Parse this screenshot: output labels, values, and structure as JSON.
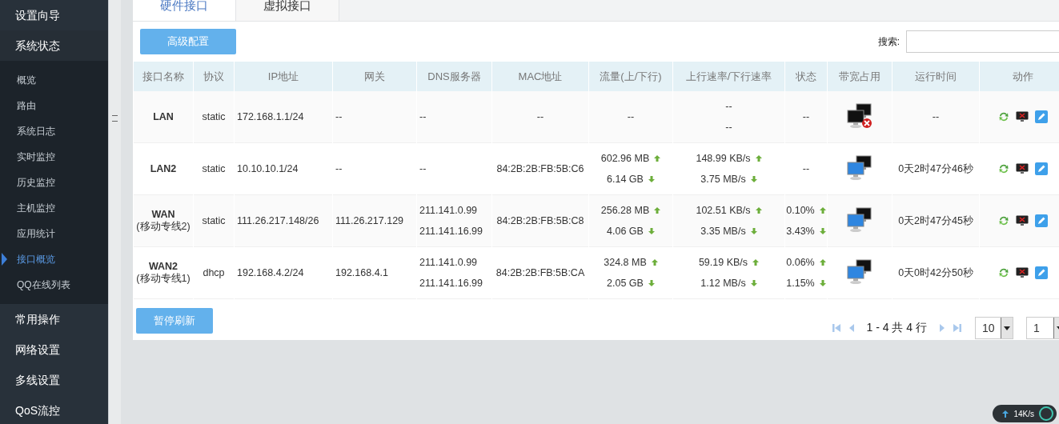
{
  "sidebar": {
    "sections": [
      {
        "label": "设置向导"
      },
      {
        "label": "系统状态",
        "children": [
          {
            "label": "概览",
            "selected": false
          },
          {
            "label": "路由",
            "selected": false
          },
          {
            "label": "系统日志",
            "selected": false
          },
          {
            "label": "实时监控",
            "selected": false
          },
          {
            "label": "历史监控",
            "selected": false
          },
          {
            "label": "主机监控",
            "selected": false
          },
          {
            "label": "应用统计",
            "selected": false
          },
          {
            "label": "接口概览",
            "selected": true
          },
          {
            "label": "QQ在线列表",
            "selected": false
          }
        ]
      },
      {
        "label": "常用操作"
      },
      {
        "label": "网络设置"
      },
      {
        "label": "多线设置"
      },
      {
        "label": "QoS流控"
      }
    ]
  },
  "tabs": [
    {
      "label": "硬件接口",
      "selected": true
    },
    {
      "label": "虚拟接口",
      "selected": false
    }
  ],
  "toolbar": {
    "config_button": "高级配置",
    "search_label": "搜索:"
  },
  "table": {
    "columns": [
      "接口名称",
      "协议",
      "IP地址",
      "网关",
      "DNS服务器",
      "MAC地址",
      "流量(上/下行)",
      "上行速率/下行速率",
      "状态",
      "带宽占用",
      "运行时间",
      "动作"
    ],
    "rows": [
      {
        "name": "LAN",
        "protocol": "static",
        "ip": "172.168.1.1/24",
        "gateway": "--",
        "dns": [
          "--"
        ],
        "mac": "--",
        "traffic": [
          {
            "text": "--",
            "kind": "plain"
          }
        ],
        "rate": [
          {
            "text": "--",
            "kind": "plain"
          },
          {
            "text": "--",
            "kind": "plain"
          }
        ],
        "connected": false,
        "bandwidth": [
          {
            "text": "--",
            "kind": "plain"
          }
        ],
        "uptime": "--"
      },
      {
        "name": "LAN2",
        "protocol": "static",
        "ip": "10.10.10.1/24",
        "gateway": "--",
        "dns": [
          "--"
        ],
        "mac": "84:2B:2B:FB:5B:C6",
        "traffic": [
          {
            "text": "602.96 MB",
            "kind": "up"
          },
          {
            "text": "6.14 GB",
            "kind": "down"
          }
        ],
        "rate": [
          {
            "text": "148.99 KB/s",
            "kind": "up"
          },
          {
            "text": "3.75 MB/s",
            "kind": "down"
          }
        ],
        "connected": true,
        "bandwidth": [
          {
            "text": "--",
            "kind": "plain"
          }
        ],
        "uptime": "0天2时47分46秒"
      },
      {
        "name": "WAN",
        "note": "(移动专线2)",
        "protocol": "static",
        "ip": "111.26.217.148/26",
        "gateway": "111.26.217.129",
        "dns": [
          "211.141.0.99",
          "211.141.16.99"
        ],
        "mac": "84:2B:2B:FB:5B:C8",
        "traffic": [
          {
            "text": "256.28 MB",
            "kind": "up"
          },
          {
            "text": "4.06 GB",
            "kind": "down"
          }
        ],
        "rate": [
          {
            "text": "102.51 KB/s",
            "kind": "up"
          },
          {
            "text": "3.35 MB/s",
            "kind": "down"
          }
        ],
        "connected": true,
        "bandwidth": [
          {
            "text": "0.10%",
            "kind": "up"
          },
          {
            "text": "3.43%",
            "kind": "down"
          }
        ],
        "uptime": "0天2时47分45秒"
      },
      {
        "name": "WAN2",
        "note": "(移动专线1)",
        "protocol": "dhcp",
        "ip": "192.168.4.2/24",
        "gateway": "192.168.4.1",
        "dns": [
          "211.141.0.99",
          "211.141.16.99"
        ],
        "mac": "84:2B:2B:FB:5B:CA",
        "traffic": [
          {
            "text": "324.8 MB",
            "kind": "up"
          },
          {
            "text": "2.05 GB",
            "kind": "down"
          }
        ],
        "rate": [
          {
            "text": "59.19 KB/s",
            "kind": "up"
          },
          {
            "text": "1.12 MB/s",
            "kind": "down"
          }
        ],
        "connected": true,
        "bandwidth": [
          {
            "text": "0.06%",
            "kind": "up"
          },
          {
            "text": "1.15%",
            "kind": "down"
          }
        ],
        "uptime": "0天0时42分50秒"
      }
    ]
  },
  "footer": {
    "pause_button": "暂停刷新",
    "page_info": "1 - 4 共 4 行",
    "page_size": "10",
    "page": "1"
  },
  "speed_widget": {
    "reading": "14K/s"
  }
}
